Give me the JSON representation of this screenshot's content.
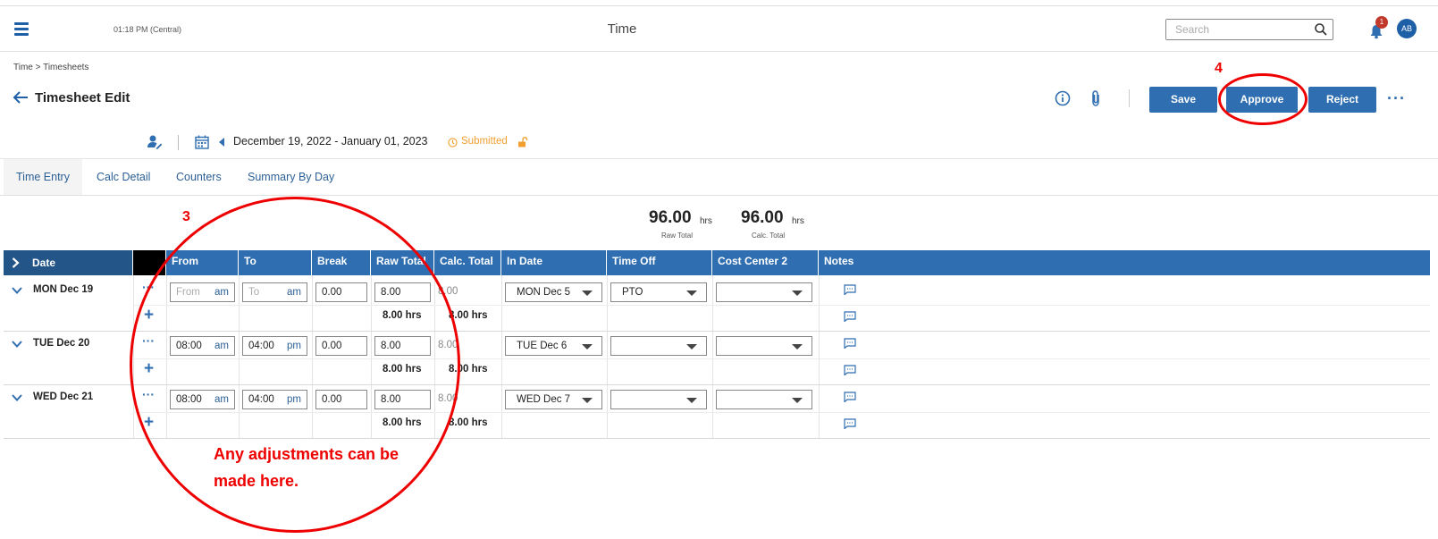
{
  "header": {
    "clock": "01:18 PM (Central)",
    "title": "Time",
    "search_placeholder": "Search",
    "notification_count": "1",
    "avatar_initials": "AB"
  },
  "breadcrumb": {
    "root": "Time",
    "separator": ">",
    "current": "Timesheets"
  },
  "page": {
    "title": "Timesheet Edit"
  },
  "actions": {
    "save": "Save",
    "approve": "Approve",
    "reject": "Reject",
    "more": "···"
  },
  "period": {
    "range": "December 19, 2022 - January 01, 2023",
    "status": "Submitted"
  },
  "tabs": [
    {
      "label": "Time Entry",
      "active": true
    },
    {
      "label": "Calc Detail",
      "active": false
    },
    {
      "label": "Counters",
      "active": false
    },
    {
      "label": "Summary By Day",
      "active": false
    }
  ],
  "totals": {
    "raw": {
      "value": "96.00",
      "unit": "hrs",
      "label": "Raw Total"
    },
    "calc": {
      "value": "96.00",
      "unit": "hrs",
      "label": "Calc. Total"
    }
  },
  "columns": {
    "date": "Date",
    "from": "From",
    "to": "To",
    "break": "Break",
    "raw_total": "Raw Total",
    "calc_total": "Calc. Total",
    "in_date": "In Date",
    "time_off": "Time Off",
    "cost_center": "Cost Center 2",
    "notes": "Notes"
  },
  "rows": [
    {
      "day": "MON Dec 19",
      "from": "",
      "from_placeholder": "From",
      "from_ampm": "am",
      "to": "",
      "to_placeholder": "To",
      "to_ampm": "am",
      "break": "0.00",
      "raw": "8.00",
      "calc": "8.00",
      "in_date": "MON Dec 5",
      "time_off": "PTO",
      "cost_center": "",
      "sub_raw": "8.00 hrs",
      "sub_calc": "8.00 hrs"
    },
    {
      "day": "TUE Dec 20",
      "from": "08:00",
      "from_placeholder": "",
      "from_ampm": "am",
      "to": "04:00",
      "to_placeholder": "",
      "to_ampm": "pm",
      "break": "0.00",
      "raw": "8.00",
      "calc": "8.00",
      "in_date": "TUE Dec 6",
      "time_off": "",
      "cost_center": "",
      "sub_raw": "8.00 hrs",
      "sub_calc": "8.00 hrs"
    },
    {
      "day": "WED Dec 21",
      "from": "08:00",
      "from_placeholder": "",
      "from_ampm": "am",
      "to": "04:00",
      "to_placeholder": "",
      "to_ampm": "pm",
      "break": "0.00",
      "raw": "8.00",
      "calc": "8.00",
      "in_date": "WED Dec 7",
      "time_off": "",
      "cost_center": "",
      "sub_raw": "8.00 hrs",
      "sub_calc": "8.00 hrs"
    }
  ],
  "annotations": {
    "step3": "3",
    "step4": "4",
    "note_line1": "Any adjustments can be",
    "note_line2": "made here."
  },
  "colors": {
    "primary": "#2f6eb0",
    "header_dark": "#235588",
    "status": "#f0a030",
    "annotation": "#ee0000"
  }
}
